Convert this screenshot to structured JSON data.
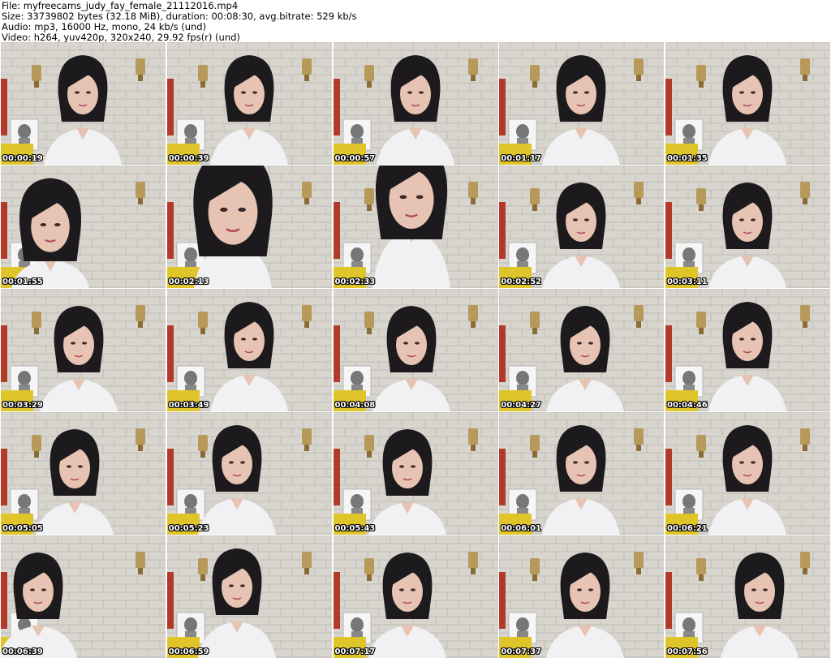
{
  "header": {
    "file_line": "File: myfreecams_judy_fay_female_21112016.mp4",
    "size_line": "Size: 33739802 bytes (32.18 MiB), duration: 00:08:30, avg.bitrate: 529 kb/s",
    "audio_line": "Audio: mp3, 16000 Hz, mono, 24 kb/s (und)",
    "video_line": "Video: h264, yuv420p, 320x240, 29.92 fps(r) (und)"
  },
  "thumbnails": [
    {
      "timestamp": "00:00:19"
    },
    {
      "timestamp": "00:00:39"
    },
    {
      "timestamp": "00:00:57"
    },
    {
      "timestamp": "00:01:17"
    },
    {
      "timestamp": "00:01:35"
    },
    {
      "timestamp": "00:01:55"
    },
    {
      "timestamp": "00:02:13"
    },
    {
      "timestamp": "00:02:33"
    },
    {
      "timestamp": "00:02:52"
    },
    {
      "timestamp": "00:03:11"
    },
    {
      "timestamp": "00:03:29"
    },
    {
      "timestamp": "00:03:49"
    },
    {
      "timestamp": "00:04:08"
    },
    {
      "timestamp": "00:04:27"
    },
    {
      "timestamp": "00:04:46"
    },
    {
      "timestamp": "00:05:05"
    },
    {
      "timestamp": "00:05:23"
    },
    {
      "timestamp": "00:05:43"
    },
    {
      "timestamp": "00:06:01"
    },
    {
      "timestamp": "00:06:21"
    },
    {
      "timestamp": "00:06:39"
    },
    {
      "timestamp": "00:06:59"
    },
    {
      "timestamp": "00:07:17"
    },
    {
      "timestamp": "00:07:37"
    },
    {
      "timestamp": "00:07:56"
    }
  ],
  "colors": {
    "wall": "#d8d5cf",
    "brick_line": "#b9b5ae",
    "hair": "#1c1a1c",
    "skin": "#e6c3b3",
    "shirt": "#f1f1f3",
    "timestamp_text": "#ffffff"
  }
}
